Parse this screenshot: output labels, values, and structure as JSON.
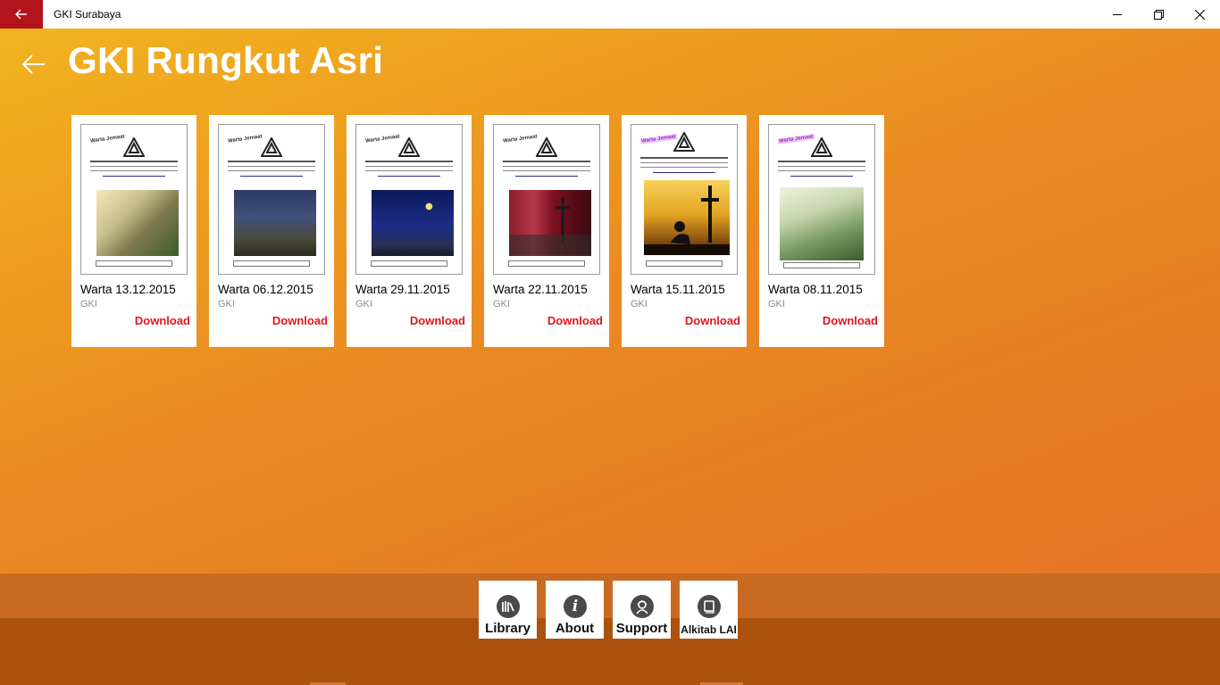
{
  "window": {
    "title": "GKI Surabaya"
  },
  "page": {
    "title": "GKI Rungkut Asri"
  },
  "cards": [
    {
      "title": "Warta 13.12.2015",
      "subtitle": "GKI",
      "action": "Download"
    },
    {
      "title": "Warta 06.12.2015",
      "subtitle": "GKI",
      "action": "Download"
    },
    {
      "title": "Warta 29.11.2015",
      "subtitle": "GKI",
      "action": "Download"
    },
    {
      "title": "Warta 22.11.2015",
      "subtitle": "GKI",
      "action": "Download"
    },
    {
      "title": "Warta 15.11.2015",
      "subtitle": "GKI",
      "action": "Download"
    },
    {
      "title": "Warta 08.11.2015",
      "subtitle": "GKI",
      "action": "Download"
    }
  ],
  "thumb_header": {
    "stamp": "Warta Jemaat",
    "org1": "GEREJA KRISTEN INDONESIA",
    "org2": "RUNGKUT ASRI - SURABAYA"
  },
  "appbar": {
    "library": "Library",
    "about": "About",
    "support": "Support",
    "alkitab": "Alkitab LAI"
  },
  "colors": {
    "accent": "#b3131b",
    "download": "#e0151d",
    "bar": "#ab520e"
  },
  "icons": [
    "back-arrow-icon",
    "minimize-icon",
    "maximize-icon",
    "close-icon",
    "library-icon",
    "info-icon",
    "support-icon",
    "bible-icon"
  ]
}
